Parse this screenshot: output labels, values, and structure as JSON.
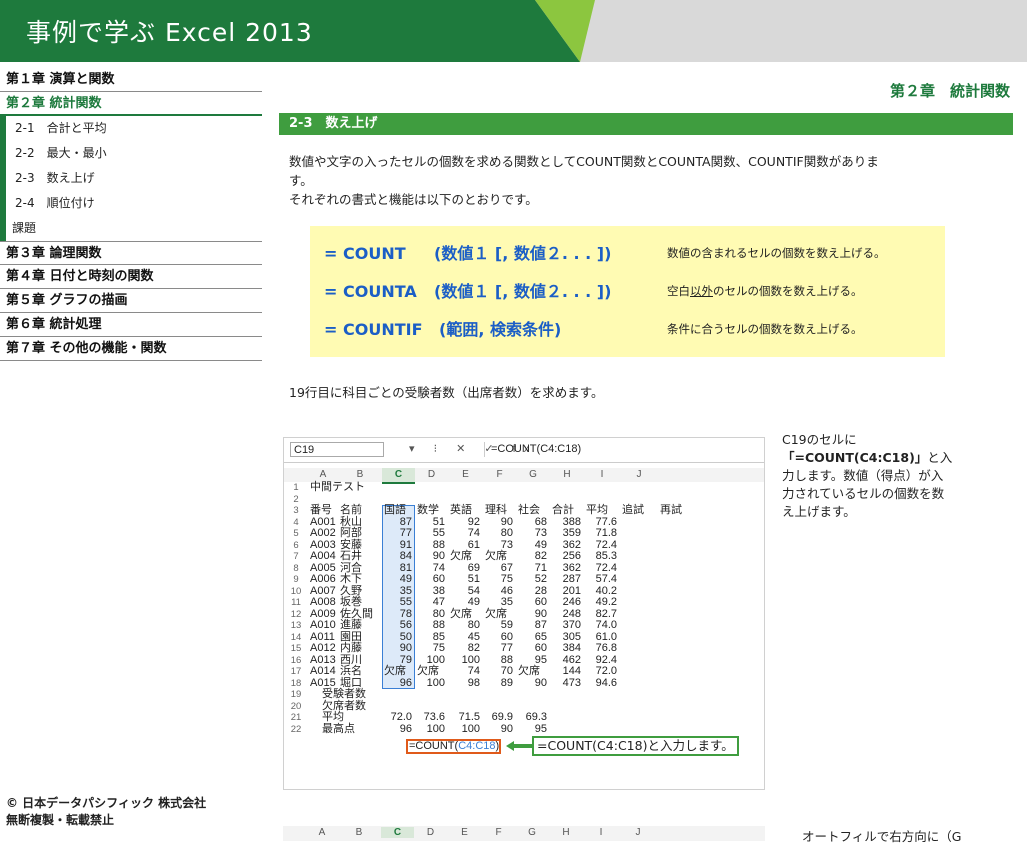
{
  "banner": {
    "title": "事例で学ぶ Excel 2013"
  },
  "nav": {
    "chapters_top": [
      {
        "label": "第１章 演算と関数"
      },
      {
        "label": "第２章 統計関数"
      }
    ],
    "subs": [
      {
        "label": "2-1　合計と平均"
      },
      {
        "label": "2-2　最大・最小"
      },
      {
        "label": "2-3　数え上げ"
      },
      {
        "label": "2-4　順位付け"
      },
      {
        "label": "課題"
      }
    ],
    "chapters_bottom": [
      {
        "label": "第３章 論理関数"
      },
      {
        "label": "第４章 日付と時刻の関数"
      },
      {
        "label": "第５章 グラフの描画"
      },
      {
        "label": "第６章 統計処理"
      },
      {
        "label": "第７章 その他の機能・関数"
      }
    ]
  },
  "footer": {
    "line1": "© 日本データパシフィック 株式会社",
    "line2": "無断複製・転載禁止"
  },
  "chapter_head": "第２章　統計関数",
  "section": "2-3　数え上げ",
  "intro": {
    "line1": "数値や文字の入ったセルの個数を求める関数としてCOUNT関数とCOUNTA関数、COUNTIF関数がありま",
    "line2": "す。",
    "line3": "それぞれの書式と機能は以下のとおりです。"
  },
  "formulas": [
    {
      "name": "= COUNT",
      "args": "(数値１ [, 数値２. . . ])",
      "desc": "数値の含まれるセルの個数を数え上げる。"
    },
    {
      "name": "= COUNTA",
      "args": "(数値１ [, 数値２. . . ])",
      "desc_pre": "空白",
      "desc_u": "以外",
      "desc_post": "のセルの個数を数え上げる。"
    },
    {
      "name": "= COUNTIF",
      "args": "(範囲, 検索条件)",
      "desc": "条件に合うセルの個数を数え上げる。"
    }
  ],
  "para19": "19行目に科目ごとの受験者数（出席者数）を求めます。",
  "excel": {
    "namebox": "C19",
    "fx_icons": "▾ ⁝ ✕ ✓ fx",
    "formula": "=COUNT(C4:C18)",
    "columns": [
      "A",
      "B",
      "C",
      "D",
      "E",
      "F",
      "G",
      "H",
      "I",
      "J"
    ],
    "rows": [
      {
        "n": "1",
        "cells": [
          "中間テスト",
          "",
          "",
          "",
          "",
          "",
          "",
          "",
          "",
          "",
          ""
        ]
      },
      {
        "n": "2",
        "cells": [
          "",
          "",
          "",
          "",
          "",
          "",
          "",
          "",
          "",
          "",
          ""
        ]
      },
      {
        "n": "3",
        "cells": [
          "番号",
          "名前",
          "国語",
          "数学",
          "英語",
          "理科",
          "社会",
          "合計",
          "平均",
          "追試",
          "再試"
        ]
      },
      {
        "n": "4",
        "cells": [
          "A001",
          "秋山",
          "87",
          "51",
          "92",
          "90",
          "68",
          "388",
          "77.6",
          "",
          ""
        ]
      },
      {
        "n": "5",
        "cells": [
          "A002",
          "阿部",
          "77",
          "55",
          "74",
          "80",
          "73",
          "359",
          "71.8",
          "",
          ""
        ]
      },
      {
        "n": "6",
        "cells": [
          "A003",
          "安藤",
          "91",
          "88",
          "61",
          "73",
          "49",
          "362",
          "72.4",
          "",
          ""
        ]
      },
      {
        "n": "7",
        "cells": [
          "A004",
          "石井",
          "84",
          "90",
          "欠席",
          "欠席",
          "82",
          "256",
          "85.3",
          "",
          ""
        ]
      },
      {
        "n": "8",
        "cells": [
          "A005",
          "河合",
          "81",
          "74",
          "69",
          "67",
          "71",
          "362",
          "72.4",
          "",
          ""
        ]
      },
      {
        "n": "9",
        "cells": [
          "A006",
          "木下",
          "49",
          "60",
          "51",
          "75",
          "52",
          "287",
          "57.4",
          "",
          ""
        ]
      },
      {
        "n": "10",
        "cells": [
          "A007",
          "久野",
          "35",
          "38",
          "54",
          "46",
          "28",
          "201",
          "40.2",
          "",
          ""
        ]
      },
      {
        "n": "11",
        "cells": [
          "A008",
          "坂巻",
          "55",
          "47",
          "49",
          "35",
          "60",
          "246",
          "49.2",
          "",
          ""
        ]
      },
      {
        "n": "12",
        "cells": [
          "A009",
          "佐久間",
          "78",
          "80",
          "欠席",
          "欠席",
          "90",
          "248",
          "82.7",
          "",
          ""
        ]
      },
      {
        "n": "13",
        "cells": [
          "A010",
          "進藤",
          "56",
          "88",
          "80",
          "59",
          "87",
          "370",
          "74.0",
          "",
          ""
        ]
      },
      {
        "n": "14",
        "cells": [
          "A011",
          "園田",
          "50",
          "85",
          "45",
          "60",
          "65",
          "305",
          "61.0",
          "",
          ""
        ]
      },
      {
        "n": "15",
        "cells": [
          "A012",
          "内藤",
          "90",
          "75",
          "82",
          "77",
          "60",
          "384",
          "76.8",
          "",
          ""
        ]
      },
      {
        "n": "16",
        "cells": [
          "A013",
          "西川",
          "79",
          "100",
          "100",
          "88",
          "95",
          "462",
          "92.4",
          "",
          ""
        ]
      },
      {
        "n": "17",
        "cells": [
          "A014",
          "浜名",
          "欠席",
          "欠席",
          "74",
          "70",
          "欠席",
          "144",
          "72.0",
          "",
          ""
        ]
      },
      {
        "n": "18",
        "cells": [
          "A015",
          "堀口",
          "96",
          "100",
          "98",
          "89",
          "90",
          "473",
          "94.6",
          "",
          ""
        ]
      },
      {
        "n": "19",
        "cells": [
          "受験者数",
          "",
          "",
          "",
          "",
          "",
          "",
          "",
          "",
          "",
          ""
        ]
      },
      {
        "n": "20",
        "cells": [
          "欠席者数",
          "",
          "",
          "",
          "",
          "",
          "",
          "",
          "",
          "",
          ""
        ]
      },
      {
        "n": "21",
        "cells": [
          "平均",
          "",
          "72.0",
          "73.6",
          "71.5",
          "69.9",
          "69.3",
          "",
          "",
          "",
          ""
        ]
      },
      {
        "n": "22",
        "cells": [
          "最高点",
          "",
          "96",
          "100",
          "100",
          "90",
          "95",
          "",
          "",
          "",
          ""
        ]
      }
    ],
    "callout_formula_pre": "=COUNT(",
    "callout_formula_ref": "C4:C18",
    "callout_formula_post": ")",
    "callout_note": "=COUNT(C4:C18)と入力します。"
  },
  "side_note": {
    "l1": "C19のセルに",
    "l2_b": "「=COUNT(C4:C18)」",
    "l2_post": "と入",
    "l3": "力します。数値（得点）が入",
    "l4": "力されているセルの個数を数",
    "l5": "え上げます。"
  },
  "excel2": {
    "columns": [
      "A",
      "B",
      "C",
      "D",
      "E",
      "F",
      "G",
      "H",
      "I",
      "J"
    ]
  },
  "side_note2": "オートフィルで右方向に（G",
  "colors": {
    "green": "#1e7a3d",
    "section_green": "#3f9d3f",
    "formula_blue": "#1b5ec6",
    "box_yellow": "#fffbb3",
    "highlight_orange": "#e05a1a"
  }
}
